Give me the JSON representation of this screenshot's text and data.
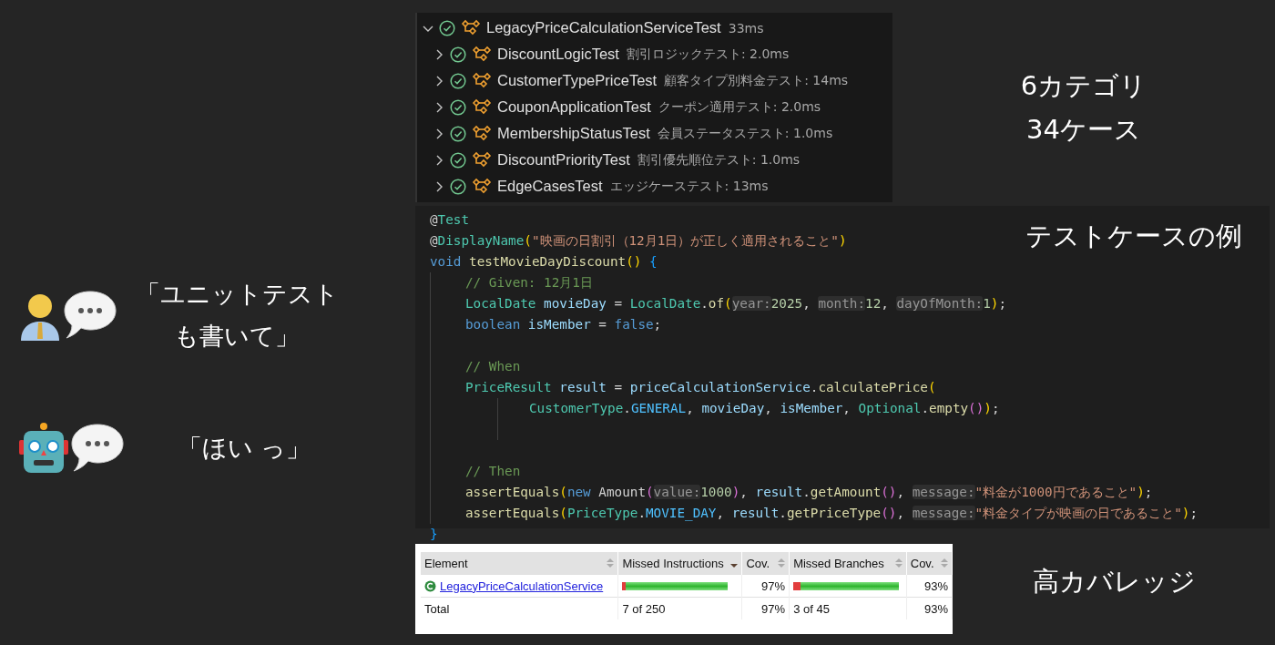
{
  "dialogue": [
    {
      "kind": "person",
      "lines": [
        "「ユニットテスト",
        "も書いて」"
      ]
    },
    {
      "kind": "robot",
      "lines": [
        "「ほい っ」"
      ]
    }
  ],
  "test_tree": {
    "name": "LegacyPriceCalculationServiceTest",
    "detail": "33ms",
    "passed": true,
    "expanded": true,
    "children": [
      {
        "name": "DiscountLogicTest",
        "detail": "割引ロジックテスト: 2.0ms",
        "passed": true,
        "expanded": false
      },
      {
        "name": "CustomerTypePriceTest",
        "detail": "顧客タイプ別料金テスト: 14ms",
        "passed": true,
        "expanded": false
      },
      {
        "name": "CouponApplicationTest",
        "detail": "クーポン適用テスト: 2.0ms",
        "passed": true,
        "expanded": false
      },
      {
        "name": "MembershipStatusTest",
        "detail": "会員ステータステスト: 1.0ms",
        "passed": true,
        "expanded": false
      },
      {
        "name": "DiscountPriorityTest",
        "detail": "割引優先順位テスト: 1.0ms",
        "passed": true,
        "expanded": false
      },
      {
        "name": "EdgeCasesTest",
        "detail": "エッジケーステスト: 13ms",
        "passed": true,
        "expanded": false
      }
    ]
  },
  "tree_caption": [
    "6カテゴリ",
    "34ケース"
  ],
  "code": {
    "header": [
      {
        "kind": "code",
        "tokens": [
          {
            "kind": "annot",
            "text": "@"
          },
          {
            "kind": "type",
            "text": "Test"
          }
        ]
      },
      {
        "kind": "code",
        "tokens": [
          {
            "kind": "plain",
            "text": "@"
          },
          {
            "kind": "type",
            "text": "DisplayName"
          },
          {
            "kind": "p1",
            "text": "("
          },
          {
            "kind": "str",
            "text": "\"映画の日割引（12月1日）が正しく適用されること\""
          },
          {
            "kind": "p1",
            "text": ")"
          }
        ]
      },
      {
        "kind": "code",
        "tokens": [
          {
            "kind": "kw",
            "text": "void"
          },
          {
            "kind": "fn",
            "text": " testMovieDayDiscount"
          },
          {
            "kind": "p1",
            "text": "() "
          },
          {
            "kind": "brace",
            "text": "{"
          }
        ]
      }
    ],
    "body": [
      {
        "kind": "code",
        "tokens": [
          {
            "kind": "comment",
            "text": "// Given: 12月1日"
          }
        ]
      },
      {
        "kind": "code",
        "tokens": [
          {
            "kind": "type",
            "text": "LocalDate"
          },
          {
            "kind": "var",
            "text": " movieDay"
          },
          {
            "kind": "plain",
            "text": " = "
          },
          {
            "kind": "type",
            "text": "LocalDate"
          },
          {
            "kind": "plain",
            "text": "."
          },
          {
            "kind": "fn",
            "text": "of"
          },
          {
            "kind": "p1",
            "text": "("
          },
          {
            "kind": "hint",
            "text": "year:"
          },
          {
            "kind": "num",
            "text": "2025"
          },
          {
            "kind": "plain",
            "text": ", "
          },
          {
            "kind": "hint",
            "text": "month:"
          },
          {
            "kind": "num",
            "text": "12"
          },
          {
            "kind": "plain",
            "text": ", "
          },
          {
            "kind": "hint",
            "text": "dayOfMonth:"
          },
          {
            "kind": "num",
            "text": "1"
          },
          {
            "kind": "p1",
            "text": ")"
          },
          {
            "kind": "plain",
            "text": ";"
          }
        ]
      },
      {
        "kind": "code",
        "tokens": [
          {
            "kind": "kw",
            "text": "boolean"
          },
          {
            "kind": "var",
            "text": " isMember"
          },
          {
            "kind": "plain",
            "text": " = "
          },
          {
            "kind": "kw",
            "text": "false"
          },
          {
            "kind": "plain",
            "text": ";"
          }
        ]
      },
      {
        "kind": "blank"
      },
      {
        "kind": "code",
        "tokens": [
          {
            "kind": "comment",
            "text": "// When"
          }
        ]
      },
      {
        "kind": "code",
        "tokens": [
          {
            "kind": "type",
            "text": "PriceResult"
          },
          {
            "kind": "var",
            "text": " result"
          },
          {
            "kind": "plain",
            "text": " = "
          },
          {
            "kind": "var",
            "text": "priceCalculationService"
          },
          {
            "kind": "plain",
            "text": "."
          },
          {
            "kind": "fn",
            "text": "calculatePrice"
          },
          {
            "kind": "p1",
            "text": "("
          }
        ]
      },
      {
        "kind": "cont",
        "tokens": [
          {
            "kind": "type",
            "text": "CustomerType"
          },
          {
            "kind": "plain",
            "text": "."
          },
          {
            "kind": "const",
            "text": "GENERAL"
          },
          {
            "kind": "plain",
            "text": ", "
          },
          {
            "kind": "var",
            "text": "movieDay"
          },
          {
            "kind": "plain",
            "text": ", "
          },
          {
            "kind": "var",
            "text": "isMember"
          },
          {
            "kind": "plain",
            "text": ", "
          },
          {
            "kind": "type",
            "text": "Optional"
          },
          {
            "kind": "plain",
            "text": "."
          },
          {
            "kind": "fn",
            "text": "empty"
          },
          {
            "kind": "p2",
            "text": "()"
          },
          {
            "kind": "p1",
            "text": ")"
          },
          {
            "kind": "plain",
            "text": ";"
          }
        ]
      },
      {
        "kind": "cont-blank"
      },
      {
        "kind": "blank"
      },
      {
        "kind": "code",
        "tokens": [
          {
            "kind": "comment",
            "text": "// Then"
          }
        ]
      },
      {
        "kind": "code",
        "tokens": [
          {
            "kind": "fn",
            "text": "assertEquals"
          },
          {
            "kind": "p1",
            "text": "("
          },
          {
            "kind": "kw",
            "text": "new"
          },
          {
            "kind": "plain",
            "text": " Amount"
          },
          {
            "kind": "p2",
            "text": "("
          },
          {
            "kind": "hint",
            "text": "value:"
          },
          {
            "kind": "num",
            "text": "1000"
          },
          {
            "kind": "p2",
            "text": ")"
          },
          {
            "kind": "plain",
            "text": ", "
          },
          {
            "kind": "var",
            "text": "result"
          },
          {
            "kind": "plain",
            "text": "."
          },
          {
            "kind": "fn",
            "text": "getAmount"
          },
          {
            "kind": "p2",
            "text": "()"
          },
          {
            "kind": "plain",
            "text": ", "
          },
          {
            "kind": "hint",
            "text": "message:"
          },
          {
            "kind": "str",
            "text": "\"料金が1000円であること\""
          },
          {
            "kind": "p1",
            "text": ")"
          },
          {
            "kind": "plain",
            "text": ";"
          }
        ]
      },
      {
        "kind": "code",
        "tokens": [
          {
            "kind": "fn",
            "text": "assertEquals"
          },
          {
            "kind": "p1",
            "text": "("
          },
          {
            "kind": "type",
            "text": "PriceType"
          },
          {
            "kind": "plain",
            "text": "."
          },
          {
            "kind": "const",
            "text": "MOVIE_DAY"
          },
          {
            "kind": "plain",
            "text": ", "
          },
          {
            "kind": "var",
            "text": "result"
          },
          {
            "kind": "plain",
            "text": "."
          },
          {
            "kind": "fn",
            "text": "getPriceType"
          },
          {
            "kind": "p2",
            "text": "()"
          },
          {
            "kind": "plain",
            "text": ", "
          },
          {
            "kind": "hint",
            "text": "message:"
          },
          {
            "kind": "str",
            "text": "\"料金タイプが映画の日であること\""
          },
          {
            "kind": "p1",
            "text": ")"
          },
          {
            "kind": "plain",
            "text": ";"
          }
        ]
      }
    ],
    "footer": [
      {
        "kind": "code",
        "tokens": [
          {
            "kind": "brace",
            "text": "}"
          }
        ]
      }
    ]
  },
  "code_caption": "テストケースの例",
  "coverage": {
    "columns": [
      {
        "label": "Element",
        "sorted": false
      },
      {
        "label": "Missed Instructions",
        "sorted": true
      },
      {
        "label": "Cov.",
        "sorted": false
      },
      {
        "label": "Missed Branches",
        "sorted": false
      },
      {
        "label": "Cov.",
        "sorted": false
      }
    ],
    "rows": [
      {
        "kind": "class",
        "element": "LegacyPriceCalculationService",
        "instructions": {
          "level": 0.97
        },
        "instructions_cov": "97%",
        "branches": {
          "level": 0.93
        },
        "branches_cov": "93%"
      },
      {
        "kind": "total",
        "element": "Total",
        "instructions": {
          "text": "7 of 250"
        },
        "instructions_cov": "97%",
        "branches": {
          "text": "3 of 45"
        },
        "branches_cov": "93%"
      }
    ]
  },
  "coverage_caption": "高カバレッジ"
}
